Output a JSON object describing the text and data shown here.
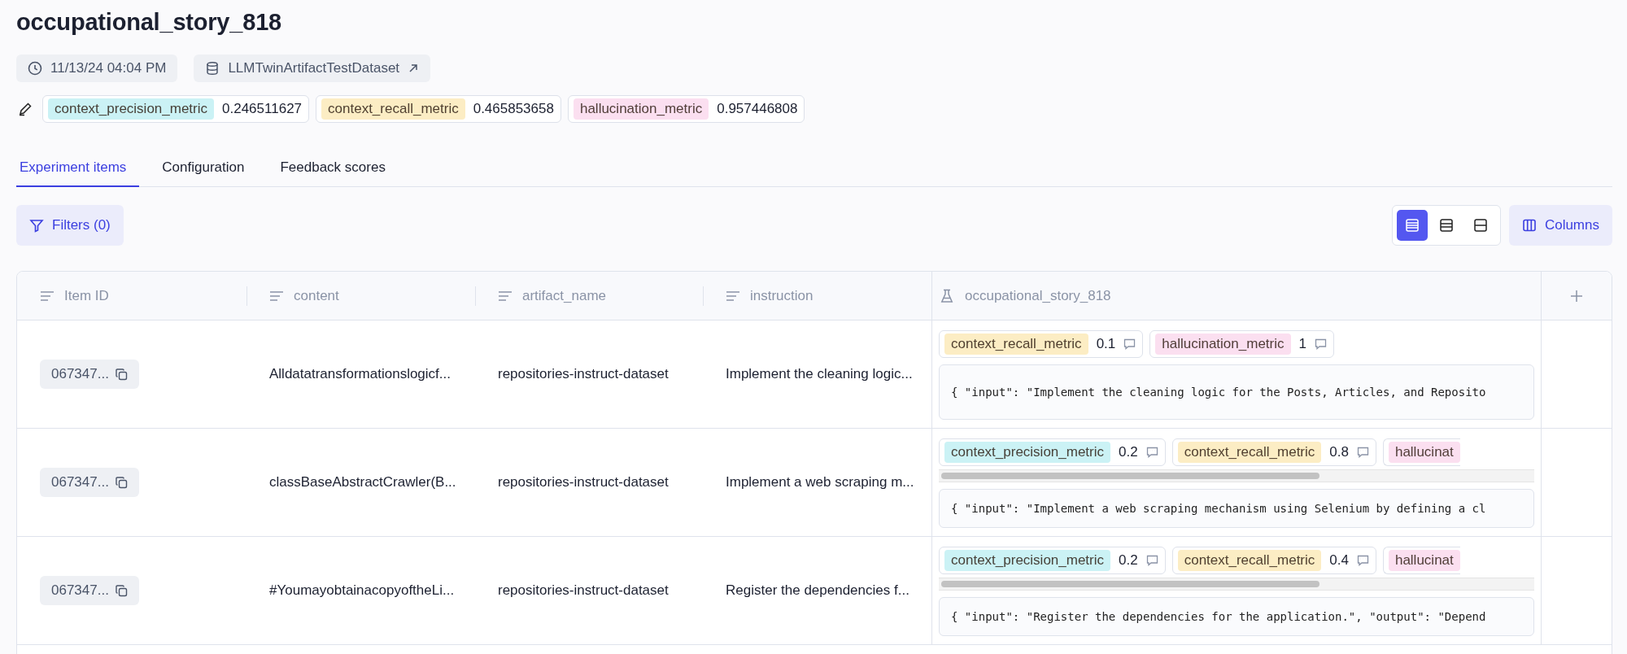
{
  "title": "occupational_story_818",
  "meta": [
    {
      "kind": "time",
      "text": "11/13/24 04:04 PM"
    },
    {
      "kind": "dataset",
      "text": "LLMTwinArtifactTestDataset"
    }
  ],
  "metrics": [
    {
      "name": "context_precision_metric",
      "value": "0.246511627",
      "color": "#cbf2f5"
    },
    {
      "name": "context_recall_metric",
      "value": "0.465853658",
      "color": "#fcedc4"
    },
    {
      "name": "hallucination_metric",
      "value": "0.957446808",
      "color": "#fbdff0"
    }
  ],
  "tabs": [
    {
      "label": "Experiment items",
      "selected": true
    },
    {
      "label": "Configuration",
      "selected": false
    },
    {
      "label": "Feedback scores",
      "selected": false
    }
  ],
  "filters_button": "Filters (0)",
  "view_modes": [
    {
      "selected": true
    },
    {
      "selected": false
    },
    {
      "selected": false
    }
  ],
  "columns_button": "Columns",
  "table": {
    "columns": [
      {
        "label": "Item ID",
        "kind": "field"
      },
      {
        "label": "content",
        "kind": "field"
      },
      {
        "label": "artifact_name",
        "kind": "field"
      },
      {
        "label": "instruction",
        "kind": "field"
      },
      {
        "label": "occupational_story_818",
        "kind": "experiment"
      }
    ],
    "rows": [
      {
        "item_id": "067347...",
        "content": "Alldatatransformationslogicf...",
        "artifact_name": "repositories-instruct-dataset",
        "instruction": "Implement the cleaning logic...",
        "scrollable": false,
        "output": "{ \"input\": \"Implement the cleaning logic for the Posts, Articles, and Reposito",
        "scores": [
          {
            "name": "context_recall_metric",
            "value": "0.1",
            "color": "#fcedc4"
          },
          {
            "name": "hallucination_metric",
            "value": "1",
            "color": "#fbdff0"
          }
        ]
      },
      {
        "item_id": "067347...",
        "content": "classBaseAbstractCrawler(B...",
        "artifact_name": "repositories-instruct-dataset",
        "instruction": "Implement a web scraping m...",
        "scrollable": true,
        "output": "{ \"input\": \"Implement a web scraping mechanism using Selenium by defining a cl",
        "scores": [
          {
            "name": "context_precision_metric",
            "value": "0.2",
            "color": "#cbf2f5"
          },
          {
            "name": "context_recall_metric",
            "value": "0.8",
            "color": "#fcedc4"
          },
          {
            "name": "hallucinat",
            "color": "#fbdff0"
          }
        ]
      },
      {
        "item_id": "067347...",
        "content": "#YoumayobtainacopyoftheLi...",
        "artifact_name": "repositories-instruct-dataset",
        "instruction": "Register the dependencies f...",
        "scrollable": true,
        "output": "{ \"input\": \"Register the dependencies for the application.\", \"output\": \"Depend",
        "scores": [
          {
            "name": "context_precision_metric",
            "value": "0.2",
            "color": "#cbf2f5"
          },
          {
            "name": "context_recall_metric",
            "value": "0.4",
            "color": "#fcedc4"
          },
          {
            "name": "hallucinat",
            "color": "#fbdff0"
          }
        ]
      }
    ]
  }
}
